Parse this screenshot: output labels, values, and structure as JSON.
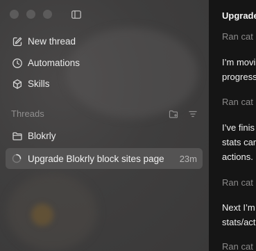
{
  "sidebar": {
    "nav": [
      {
        "label": "New thread",
        "icon": "edit-icon"
      },
      {
        "label": "Automations",
        "icon": "clock-icon"
      },
      {
        "label": "Skills",
        "icon": "cube-icon"
      }
    ],
    "threads_title": "Threads",
    "folder": {
      "label": "Blokrly",
      "icon": "folder-icon"
    },
    "active_thread": {
      "label": "Upgrade Blokrly block sites page",
      "time": "23m"
    }
  },
  "main": {
    "title": "Upgrade",
    "lines": [
      {
        "text": "Ran cat",
        "style": "muted"
      },
      {
        "text": "I’m movi",
        "style": "strong"
      },
      {
        "text": "progress",
        "style": "strong"
      },
      {
        "text": "Ran cat",
        "style": "muted"
      },
      {
        "text": "I’ve finis",
        "style": "strong"
      },
      {
        "text": "stats car",
        "style": "strong"
      },
      {
        "text": "actions.",
        "style": "strong"
      },
      {
        "text": "Ran cat",
        "style": "muted"
      },
      {
        "text": "Next I’m",
        "style": "strong"
      },
      {
        "text": "stats/act",
        "style": "strong"
      },
      {
        "text": "Ran cat",
        "style": "muted"
      }
    ]
  },
  "colors": {
    "sidebar_bg": "#3f3e3e",
    "main_bg": "#151515",
    "active_row": "#545353",
    "text": "#ebebeb",
    "muted": "#8a8989"
  }
}
